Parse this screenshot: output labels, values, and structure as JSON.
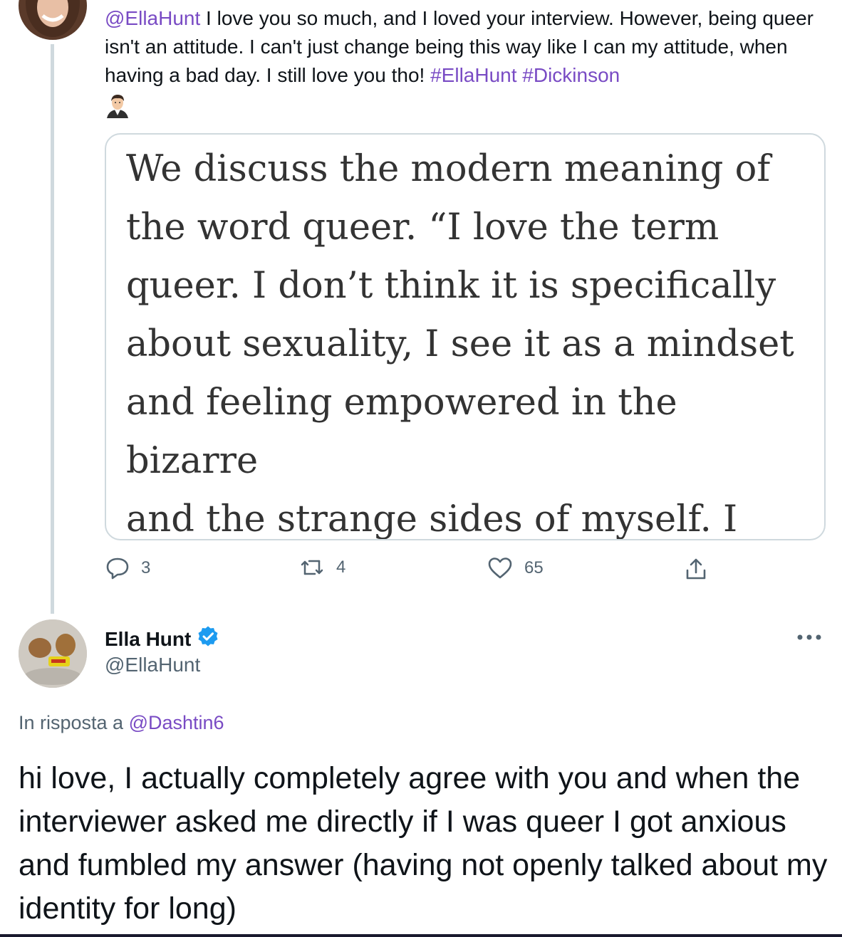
{
  "parent_tweet": {
    "mention": "@EllaHunt",
    "text": " I love you so much, and I loved your interview. However, being queer isn't an attitude. I can't just change being this way like I can my attitude, when having a bad day. I still love you tho! ",
    "hashtags": [
      "#EllaHunt",
      "#Dickinson"
    ],
    "quoted_image_text": "We discuss the modern meaning of\nthe word queer. “I love the term\nqueer. I don’t think it is specifically\nabout sexuality, I see it as a mindset\nand feeling empowered in the bizarre\nand the strange sides of myself. I\nthink queer is a beautiful word in",
    "stats": {
      "replies": "3",
      "retweets": "4",
      "likes": "65"
    }
  },
  "reply_tweet": {
    "author_name": "Ella Hunt",
    "author_handle": "@EllaHunt",
    "verified": true,
    "reply_prefix": "In risposta a ",
    "reply_to": "@Dashtin6",
    "text": "hi love, I actually completely agree with you and when the interviewer asked me directly if I was queer I got anxious and fumbled my answer (having not openly talked about my identity for long)"
  },
  "colors": {
    "link": "#794bc4",
    "verified": "#1d9bf0",
    "secondary_text": "#536471",
    "thread_line": "#cfd9de"
  }
}
